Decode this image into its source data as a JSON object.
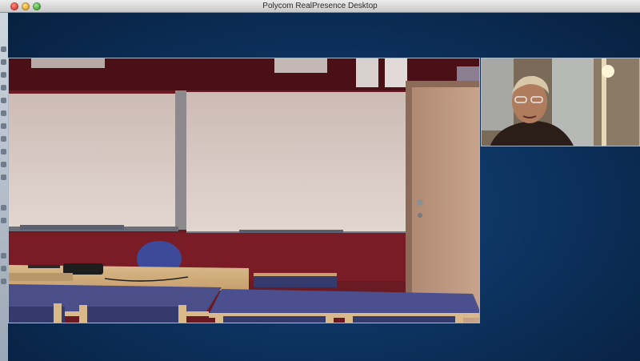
{
  "window": {
    "title": "Polycom RealPresence Desktop"
  },
  "video": {
    "remote_feed": "remote-conference-room-video",
    "local_feed": "self-view-video"
  },
  "colors": {
    "background": "#0d3462",
    "wall": "#6a1a22",
    "whiteboard": "#d8c8c3",
    "table": "#4a4f8a"
  }
}
